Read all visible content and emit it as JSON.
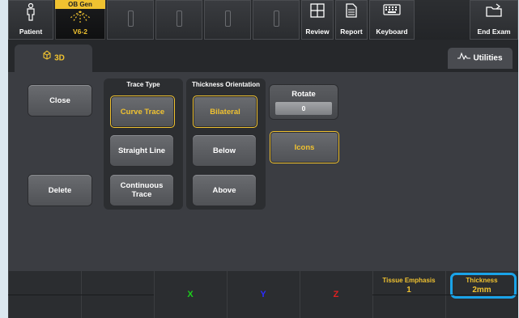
{
  "topbar": {
    "patient_label": "Patient",
    "probe_title": "OB Gen",
    "probe_name": "V6-2",
    "review_label": "Review",
    "report_label": "Report",
    "keyboard_label": "Keyboard",
    "end_exam_label": "End Exam"
  },
  "tabs": {
    "active_label": "3D",
    "utilities_label": "Utilities"
  },
  "panel": {
    "close_label": "Close",
    "delete_label": "Delete",
    "trace_type": {
      "title": "Trace Type",
      "options": [
        "Curve Trace",
        "Straight Line",
        "Continuous Trace"
      ],
      "selected": "Curve Trace"
    },
    "thickness_orientation": {
      "title": "Thickness Orientation",
      "options": [
        "Bilateral",
        "Below",
        "Above"
      ],
      "selected": "Bilateral"
    },
    "rotate": {
      "title": "Rotate",
      "value": "0"
    },
    "icons_label": "Icons"
  },
  "bottom": {
    "axis_x": "X",
    "axis_y": "Y",
    "axis_z": "Z",
    "tissue_emphasis": {
      "label": "Tissue Emphasis",
      "value": "1"
    },
    "thickness": {
      "label": "Thickness",
      "value": "2mm"
    }
  },
  "colors": {
    "accent": "#f0c230",
    "axis_x": "#1bd11b",
    "axis_y": "#2b2bff",
    "axis_z": "#e02020",
    "highlight": "#1aa3e8"
  }
}
